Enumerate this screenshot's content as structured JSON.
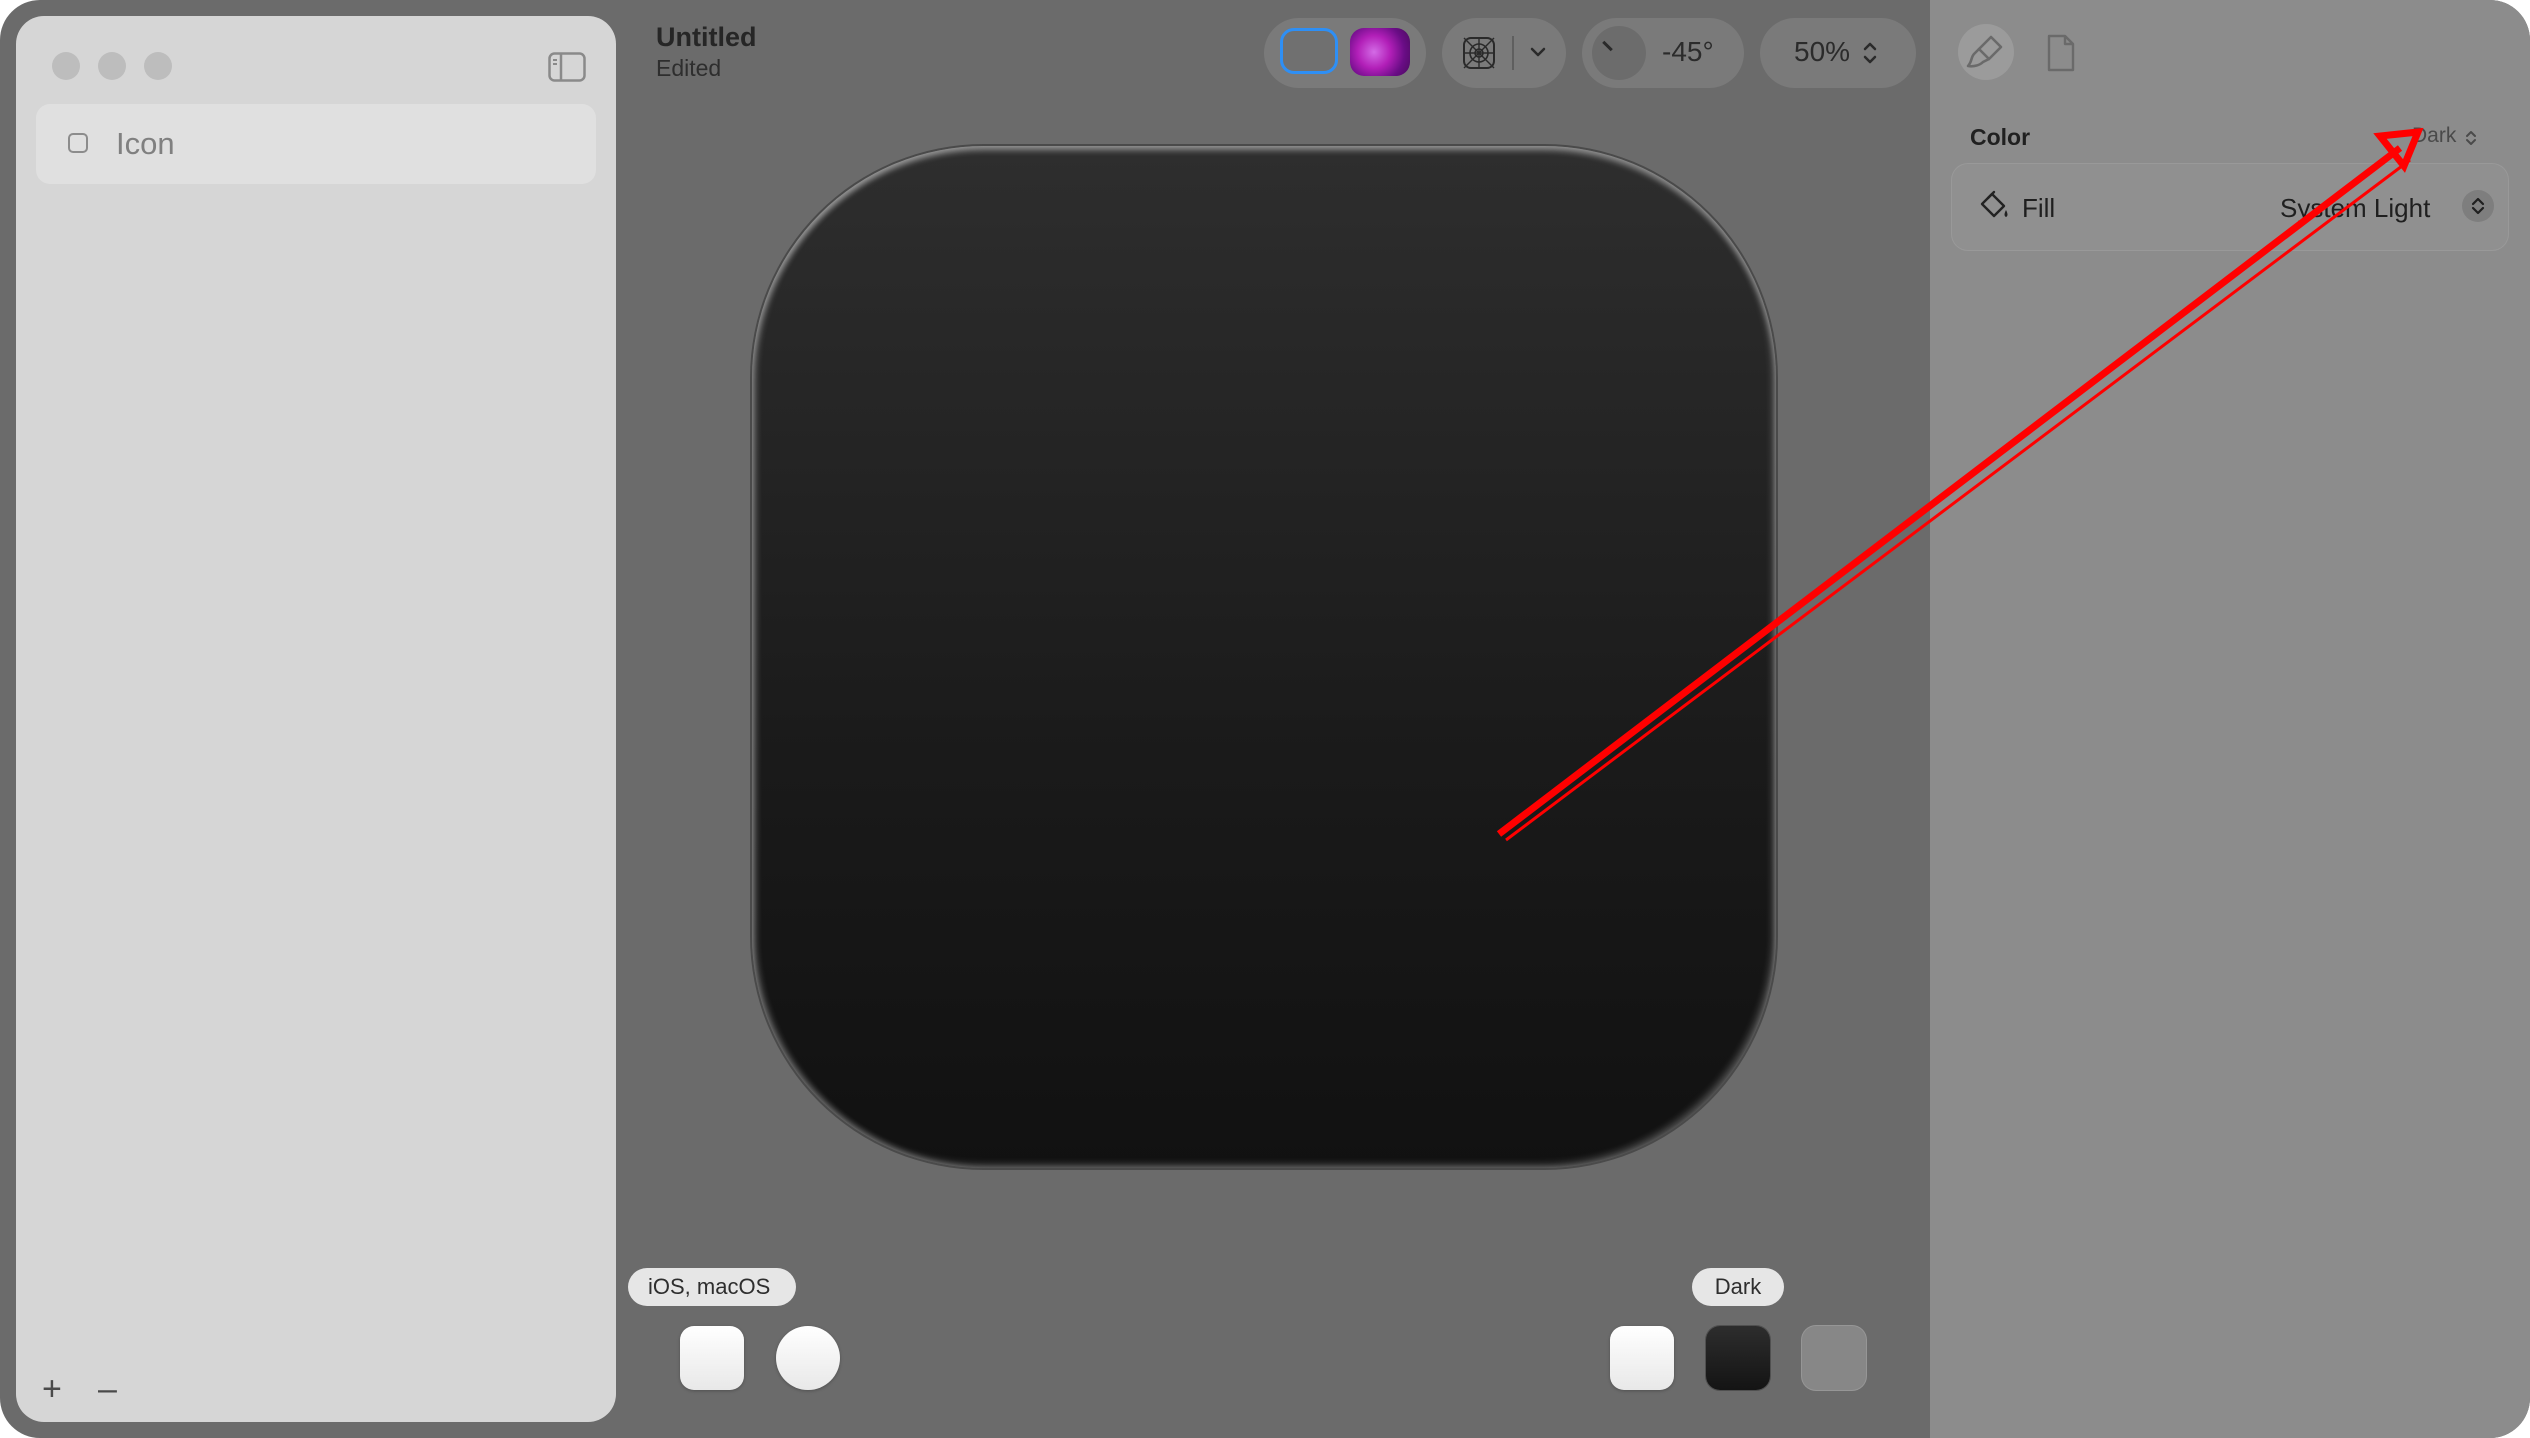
{
  "window": {
    "title": "Untitled",
    "status": "Edited"
  },
  "sidebar": {
    "layers": [
      {
        "label": "Icon"
      }
    ],
    "add_label": "+",
    "remove_label": "–"
  },
  "toolbar": {
    "angle_label": "-45°",
    "zoom_label": "50%"
  },
  "preview": {
    "left_tag": "iOS, macOS",
    "right_tag": "Dark"
  },
  "inspector": {
    "section_title": "Color",
    "appearance_select": "Dark",
    "fill_label": "Fill",
    "fill_value": "System Light"
  },
  "colors": {
    "accent": "#2e8ff5",
    "annotation": "#ff0000"
  }
}
